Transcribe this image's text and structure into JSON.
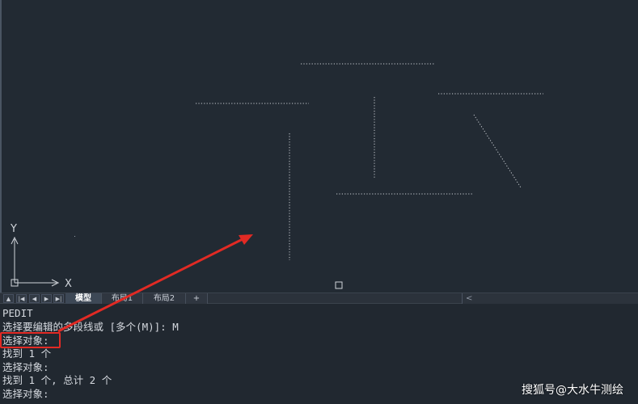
{
  "viewport": {
    "ucs": {
      "x_label": "X",
      "y_label": "Y"
    }
  },
  "tabbar": {
    "nav_icons": [
      "triangle-up-icon",
      "first-icon",
      "prev-icon",
      "next-icon",
      "last-icon"
    ],
    "tabs": [
      {
        "label": "模型",
        "active": true
      },
      {
        "label": "布局1",
        "active": false
      },
      {
        "label": "布局2",
        "active": false
      },
      {
        "label": "+",
        "active": false
      }
    ],
    "scroll_arrow": "<"
  },
  "command_history": [
    "PEDIT",
    "选择要编辑的多段线或 [多个(M)]: M",
    "选择对象:",
    "找到 1 个",
    "选择对象:",
    "找到 1 个, 总计 2 个",
    "选择对象:"
  ],
  "watermark": "搜狐号@大水牛测绘",
  "colors": {
    "annotation_red": "#e22a24",
    "dotted_line": "#c8ccd2"
  }
}
